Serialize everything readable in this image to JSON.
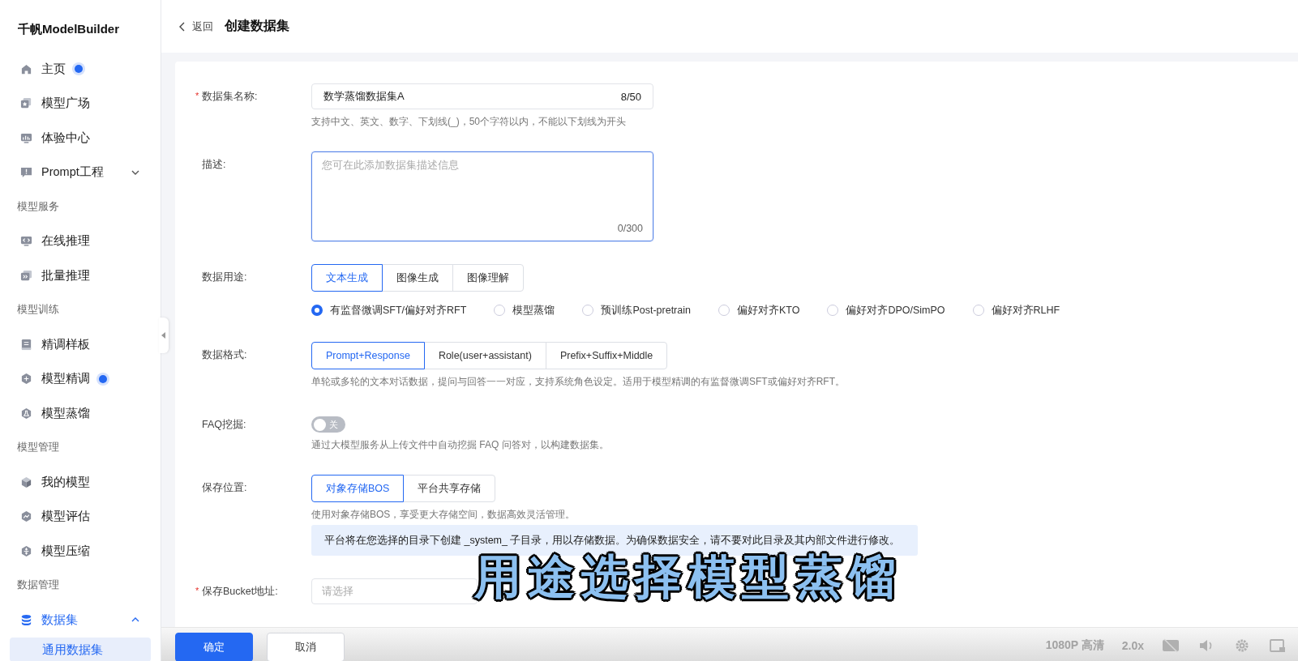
{
  "sidebar": {
    "brand": "千帆ModelBuilder",
    "nav": [
      {
        "kind": "item",
        "label": "主页",
        "dot": true,
        "selected": false
      },
      {
        "kind": "item",
        "label": "模型广场",
        "dot": false,
        "selected": false
      },
      {
        "kind": "item",
        "label": "体验中心",
        "dot": false,
        "selected": false
      },
      {
        "kind": "item",
        "label": "Prompt工程",
        "dot": false,
        "selected": false,
        "expanded": false
      },
      {
        "kind": "section",
        "label": "模型服务"
      },
      {
        "kind": "item",
        "label": "在线推理",
        "dot": false,
        "selected": false
      },
      {
        "kind": "item",
        "label": "批量推理",
        "dot": false,
        "selected": false
      },
      {
        "kind": "section",
        "label": "模型训练"
      },
      {
        "kind": "item",
        "label": "精调样板",
        "dot": false,
        "selected": false
      },
      {
        "kind": "item",
        "label": "模型精调",
        "dot": true,
        "selected": false
      },
      {
        "kind": "item",
        "label": "模型蒸馏",
        "dot": false,
        "selected": false
      },
      {
        "kind": "section",
        "label": "模型管理"
      },
      {
        "kind": "item",
        "label": "我的模型",
        "dot": false,
        "selected": false
      },
      {
        "kind": "item",
        "label": "模型评估",
        "dot": false,
        "selected": false
      },
      {
        "kind": "item",
        "label": "模型压缩",
        "dot": false,
        "selected": false
      },
      {
        "kind": "section",
        "label": "数据管理"
      },
      {
        "kind": "item",
        "label": "数据集",
        "dot": false,
        "active": true,
        "expanded": true,
        "children": [
          {
            "label": "通用数据集",
            "selected": true
          }
        ]
      }
    ]
  },
  "header": {
    "back": "返回",
    "title": "创建数据集"
  },
  "fields": [
    {
      "kind": "text",
      "label": "数据集名称:",
      "required_mark": "*",
      "value": "数学蒸馏数据集A",
      "counter": "8/50",
      "focused": false,
      "hint": "支持中文、英文、数字、下划线(_)，50个字符以内，不能以下划线为开头"
    },
    {
      "kind": "textarea",
      "label": "描述:",
      "placeholder": "您可在此添加数据集描述信息",
      "counter": "0/300",
      "focused": true
    },
    {
      "kind": "segmented",
      "label": "数据用途:",
      "options": [
        {
          "label": "文本生成",
          "selected": true
        },
        {
          "label": "图像生成",
          "selected": false
        },
        {
          "label": "图像理解",
          "selected": false
        }
      ],
      "radios": [
        {
          "label": "有监督微调SFT/偏好对齐RFT",
          "selected": true
        },
        {
          "label": "模型蒸馏",
          "selected": false
        },
        {
          "label": "预训练Post-pretrain",
          "selected": false
        },
        {
          "label": "偏好对齐KTO",
          "selected": false
        },
        {
          "label": "偏好对齐DPO/SimPO",
          "selected": false
        },
        {
          "label": "偏好对齐RLHF",
          "selected": false
        }
      ]
    },
    {
      "kind": "segmented",
      "label": "数据格式:",
      "options": [
        {
          "label": "Prompt+Response",
          "selected": true
        },
        {
          "label": "Role(user+assistant)",
          "selected": false
        },
        {
          "label": "Prefix+Suffix+Middle",
          "selected": false
        }
      ],
      "hint": "单轮或多轮的文本对话数据，提问与回答一一对应，支持系统角色设定。适用于模型精调的有监督微调SFT或偏好对齐RFT。"
    },
    {
      "kind": "toggle",
      "label": "FAQ挖掘:",
      "on": false,
      "toggle_text": "关",
      "hint": "通过大模型服务从上传文件中自动挖掘 FAQ 问答对，以构建数据集。"
    },
    {
      "kind": "segmented",
      "label": "保存位置:",
      "options": [
        {
          "label": "对象存储BOS",
          "selected": true
        },
        {
          "label": "平台共享存储",
          "selected": false
        }
      ],
      "hint": "使用对象存储BOS，享受更大存储空间，数据高效灵活管理。",
      "notice": "平台将在您选择的目录下创建 _system_ 子目录，用以存储数据。为确保数据安全，请不要对此目录及其内部文件进行修改。"
    },
    {
      "kind": "select",
      "label": "保存Bucket地址:",
      "required_mark": "*",
      "placeholder": "请选择"
    }
  ],
  "footer": {
    "buttons": [
      {
        "label": "确定",
        "kind": "primary"
      },
      {
        "label": "取消",
        "kind": "default"
      }
    ]
  },
  "player": {
    "quality": "1080P 高清",
    "speed": "2.0x"
  },
  "subtitle": "用途选择模型蒸馏"
}
